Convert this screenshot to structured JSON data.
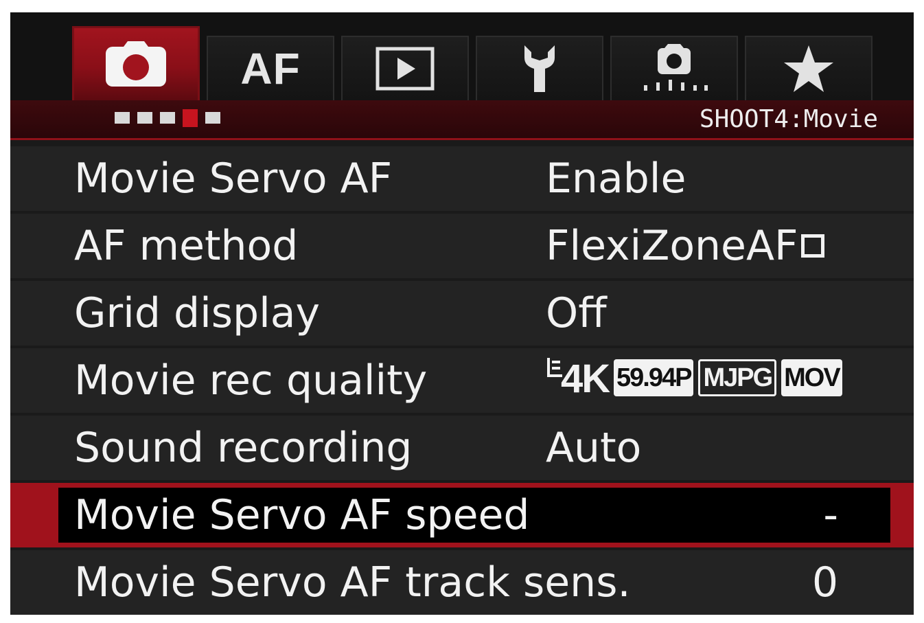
{
  "tabs": [
    {
      "icon": "camera-icon",
      "active": true
    },
    {
      "label": "AF",
      "icon": "af-icon",
      "active": false
    },
    {
      "icon": "playback-icon",
      "active": false
    },
    {
      "icon": "wrench-icon",
      "active": false
    },
    {
      "icon": "custom-functions-icon",
      "active": false
    },
    {
      "icon": "star-icon",
      "active": false
    }
  ],
  "page_indicator": {
    "total": 5,
    "current": 4
  },
  "section_title": "SHOOT4:Movie",
  "menu": {
    "items": [
      {
        "label": "Movie Servo AF",
        "value": "Enable"
      },
      {
        "label": "AF method",
        "value": "FlexiZoneAF"
      },
      {
        "label": "Grid display",
        "value": "Off"
      },
      {
        "label": "Movie rec quality",
        "value": {
          "size": "4K",
          "frame_rate": "59.94P",
          "compression": "MJPG",
          "format": "MOV"
        }
      },
      {
        "label": "Sound recording",
        "value": "Auto"
      },
      {
        "label": "Movie Servo AF speed",
        "value": "-",
        "selected": true
      },
      {
        "label": "Movie Servo AF track sens.",
        "value": "0"
      }
    ]
  },
  "colors": {
    "accent_red": "#a0121c",
    "row_bg": "#232323",
    "text": "#f2f2f2"
  }
}
